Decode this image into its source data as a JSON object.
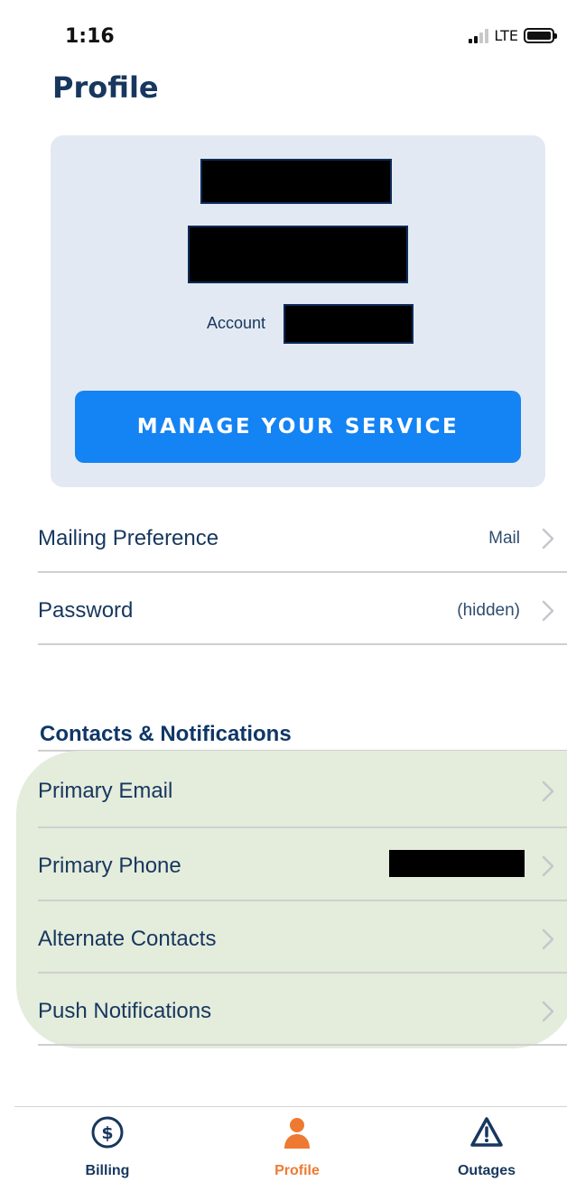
{
  "status": {
    "time": "1:16",
    "network": "LTE"
  },
  "header": {
    "title": "Profile"
  },
  "account_card": {
    "account_label": "Account",
    "manage_button_label": "MANAGE YOUR SERVICE"
  },
  "settings": [
    {
      "label": "Mailing Preference",
      "value": "Mail"
    },
    {
      "label": "Password",
      "value": "(hidden)"
    }
  ],
  "contacts": {
    "section_title": "Contacts & Notifications",
    "items": [
      {
        "label": "Primary Email"
      },
      {
        "label": "Primary Phone"
      },
      {
        "label": "Alternate Contacts"
      },
      {
        "label": "Push Notifications"
      }
    ]
  },
  "tabs": [
    {
      "label": "Billing",
      "icon": "dollar-circle-icon"
    },
    {
      "label": "Profile",
      "icon": "person-icon",
      "active": true
    },
    {
      "label": "Outages",
      "icon": "warning-triangle-icon"
    }
  ],
  "colors": {
    "brand_navy": "#17375e",
    "button_blue": "#1483f3",
    "card_bg": "#e3e9f3",
    "highlight_green": "#e4ecdc",
    "active_tab": "#ee7a32"
  }
}
